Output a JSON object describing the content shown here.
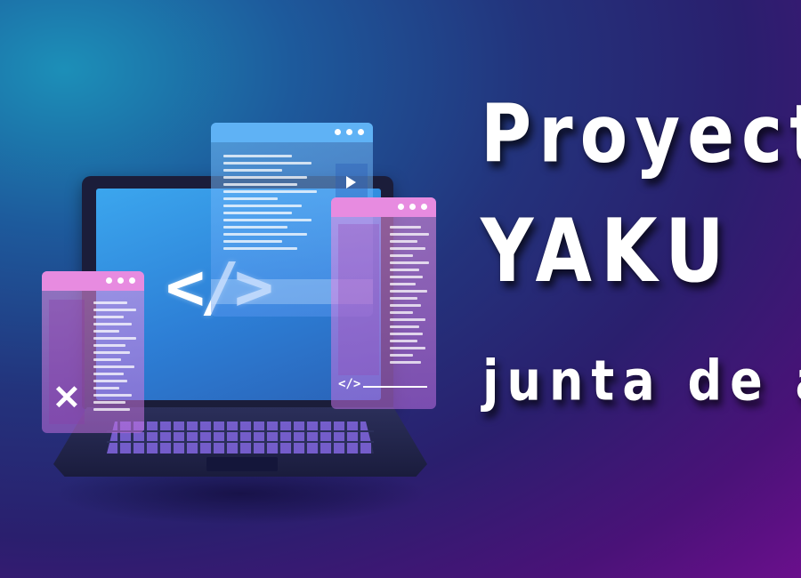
{
  "title": {
    "line1": "Proyecto",
    "line2": "YAKU",
    "line3": "junta de agua"
  },
  "illustration": {
    "laptop_code_glyph": "</>",
    "right_window_code_glyph": "</>",
    "icons": [
      "code-brackets-icon",
      "play-icon",
      "tools-icon",
      "window-dots-icon"
    ]
  },
  "colors": {
    "background_start": "#1c8fb8",
    "background_end": "#6a0f8c",
    "screen_blue": "#3ba6ee",
    "window_pink": "#e78be0",
    "window_blue": "#5fb2f5",
    "text": "#ffffff"
  }
}
